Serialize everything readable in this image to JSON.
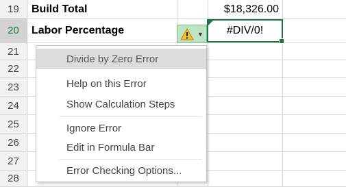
{
  "rows": [
    {
      "num": "19",
      "label": "Build Total",
      "value": "$18,326.00"
    },
    {
      "num": "20",
      "label": "Labor Percentage",
      "value": ""
    },
    {
      "num": "21"
    },
    {
      "num": "22"
    },
    {
      "num": "23"
    },
    {
      "num": "24"
    },
    {
      "num": "25"
    },
    {
      "num": "26"
    },
    {
      "num": "27"
    },
    {
      "num": "28"
    }
  ],
  "active_cell": {
    "value": "#DIV/0!"
  },
  "smart_tag": {
    "icon": "warning-icon",
    "dropdown_icon": "chevron-down-icon"
  },
  "menu": {
    "header": "Divide by Zero Error",
    "help": "Help on this Error",
    "steps": "Show Calculation Steps",
    "ignore": "Ignore Error",
    "edit_formula_bar": "Edit in Formula Bar",
    "options": "Error Checking Options..."
  },
  "colors": {
    "accent": "#217346",
    "warning": "#f2c12e"
  }
}
